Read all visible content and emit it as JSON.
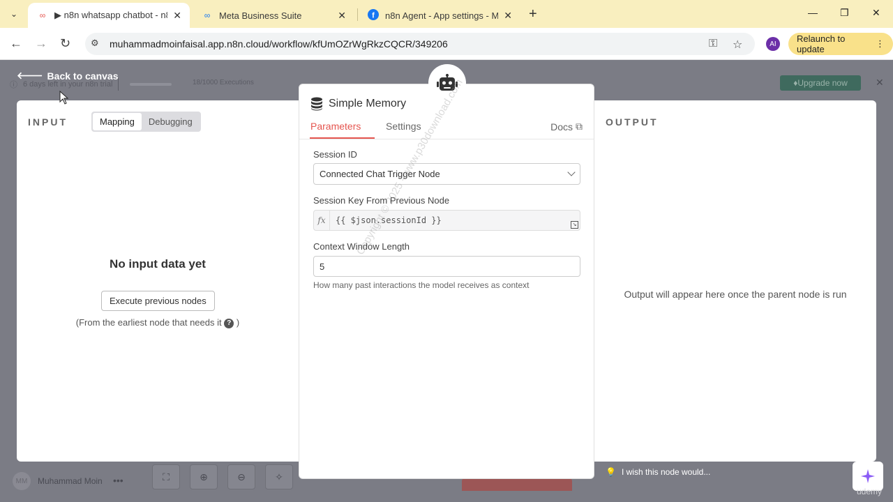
{
  "browser": {
    "tabs": [
      {
        "title": "▶ n8n whatsapp chatbot - n8n",
        "active": true
      },
      {
        "title": "Meta Business Suite",
        "active": false
      },
      {
        "title": "n8n Agent - App settings - Met",
        "active": false
      }
    ],
    "url": "muhammadmoinfaisal.app.n8n.cloud/workflow/kfUmOZrWgRkzCQCR/349206",
    "profile": "AI",
    "relaunch_label": "Relaunch to update"
  },
  "app": {
    "back_label": "Back to canvas",
    "trial_text": "6 days left in your n8n trial",
    "executions": "18/1000 Executions",
    "upgrade_label": "Upgrade now",
    "user": {
      "initials": "MM",
      "name": "Muhammad Moin"
    }
  },
  "input": {
    "title": "INPUT",
    "tabs": [
      "Mapping",
      "Debugging"
    ],
    "empty_title": "No input data yet",
    "exec_button": "Execute previous nodes",
    "note": "(From the earliest node that needs it",
    "note_end": ")"
  },
  "output": {
    "title": "OUTPUT",
    "message": "Output will appear here once the parent node is run"
  },
  "node": {
    "name": "Simple Memory",
    "tabs": [
      "Parameters",
      "Settings"
    ],
    "docs_label": "Docs",
    "session_id_label": "Session ID",
    "session_id_value": "Connected Chat Trigger Node",
    "session_key_label": "Session Key From Previous Node",
    "session_key_value": "{{ $json.sessionId }}",
    "context_label": "Context Window Length",
    "context_value": "5",
    "context_hint": "How many past interactions the model receives as context"
  },
  "watermark": "Copyright © 2025 - www.p30download.com",
  "feedback_label": "I wish this node would...",
  "brand_text": "udemy",
  "colors": {
    "accent": "#e5554f",
    "relaunch": "#f9e18a",
    "upgrade": "#3f6a5e"
  }
}
